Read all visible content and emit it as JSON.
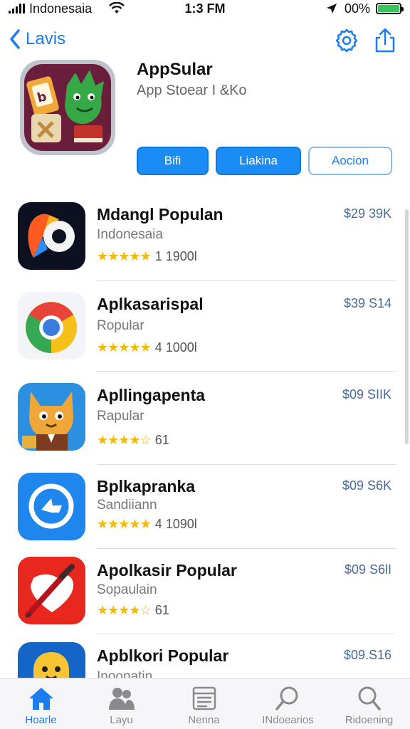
{
  "status_bar": {
    "carrier": "Indonesaia",
    "time": "1:3 FM",
    "battery_percent": "00%",
    "battery_color": "#35c759"
  },
  "nav": {
    "back_label": "Lavis",
    "icons": [
      "chevron-left-icon",
      "settings-icon",
      "share-icon"
    ]
  },
  "app": {
    "title": "AppSular",
    "subtitle": "App Stoear I &Ko",
    "buttons": [
      {
        "label": "Bifi",
        "style": "solid"
      },
      {
        "label": "Liakina",
        "style": "solid"
      },
      {
        "label": "Aocion",
        "style": "outline"
      }
    ]
  },
  "list": [
    {
      "title": "Mdangl Populan",
      "subtitle": "Indonesaia",
      "stars": "★★★★★",
      "count": "1 1900l",
      "price": "$29 39K",
      "icon": "media-app-icon"
    },
    {
      "title": "Aplkasarispal",
      "subtitle": "Ropular",
      "stars": "★★★★★",
      "count": "4 1000l",
      "price": "$39 S14",
      "icon": "chrome-icon"
    },
    {
      "title": "Apllingapenta",
      "subtitle": "Rapular",
      "stars": "★★★★☆",
      "count": "61",
      "price": "$09 SIIK",
      "icon": "cat-game-icon"
    },
    {
      "title": "Bplkapranka",
      "subtitle": "Sandiiann",
      "stars": "★★★★★",
      "count": "4 1090l",
      "price": "$09 S6K",
      "icon": "blue-arrow-app-icon"
    },
    {
      "title": "Apolkasir Popular",
      "subtitle": "Sopaulain",
      "stars": "★★★★☆",
      "count": "61",
      "price": "$09 S6lI",
      "icon": "pen-app-icon"
    },
    {
      "title": "Apblkori Popular",
      "subtitle": "Inoonatin",
      "stars": "",
      "count": "",
      "price": "$09.S16",
      "icon": "yellow-character-icon"
    }
  ],
  "tabs": [
    {
      "label": "Hoarle",
      "icon": "home-icon",
      "active": true
    },
    {
      "label": "Layu",
      "icon": "people-icon",
      "active": false
    },
    {
      "label": "Nenna",
      "icon": "list-icon",
      "active": false
    },
    {
      "label": "INdoearios",
      "icon": "search-icon",
      "active": false
    },
    {
      "label": "Ridoening",
      "icon": "search-icon",
      "active": false
    }
  ],
  "colors": {
    "accent": "#1a7cf0",
    "star": "#f5b800",
    "price": "#4a6a9a"
  }
}
